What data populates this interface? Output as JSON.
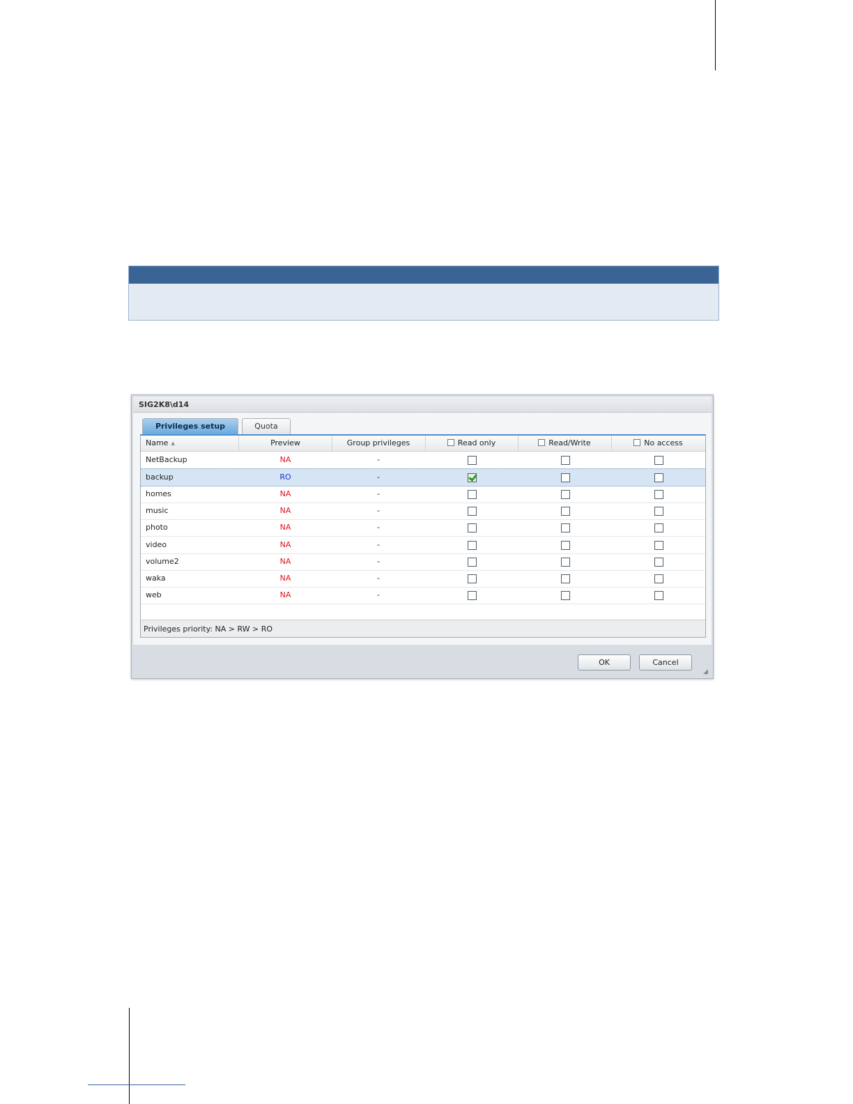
{
  "dialog": {
    "title": "SIG2K8\\d14",
    "tabs": [
      {
        "label": "Privileges setup",
        "active": true
      },
      {
        "label": "Quota",
        "active": false
      }
    ],
    "columns": {
      "name": "Name",
      "preview": "Preview",
      "group": "Group privileges",
      "read_only": "Read only",
      "read_write": "Read/Write",
      "no_access": "No access"
    },
    "rows": [
      {
        "name": "NetBackup",
        "preview": "NA",
        "group": "-",
        "ro": false,
        "rw": false,
        "na": false
      },
      {
        "name": "backup",
        "preview": "RO",
        "group": "-",
        "ro": true,
        "rw": false,
        "na": false
      },
      {
        "name": "homes",
        "preview": "NA",
        "group": "-",
        "ro": false,
        "rw": false,
        "na": false
      },
      {
        "name": "music",
        "preview": "NA",
        "group": "-",
        "ro": false,
        "rw": false,
        "na": false
      },
      {
        "name": "photo",
        "preview": "NA",
        "group": "-",
        "ro": false,
        "rw": false,
        "na": false
      },
      {
        "name": "video",
        "preview": "NA",
        "group": "-",
        "ro": false,
        "rw": false,
        "na": false
      },
      {
        "name": "volume2",
        "preview": "NA",
        "group": "-",
        "ro": false,
        "rw": false,
        "na": false
      },
      {
        "name": "waka",
        "preview": "NA",
        "group": "-",
        "ro": false,
        "rw": false,
        "na": false
      },
      {
        "name": "web",
        "preview": "NA",
        "group": "-",
        "ro": false,
        "rw": false,
        "na": false
      }
    ],
    "selected_row": "backup",
    "footer_text": "Privileges priority: NA > RW > RO",
    "ok_label": "OK",
    "cancel_label": "Cancel"
  },
  "colors": {
    "na": "#e0141c",
    "ro": "#1a2fd6",
    "note_header": "#3a6496",
    "note_body": "#e4eaf3",
    "tab_active": "#6aa9dc"
  }
}
